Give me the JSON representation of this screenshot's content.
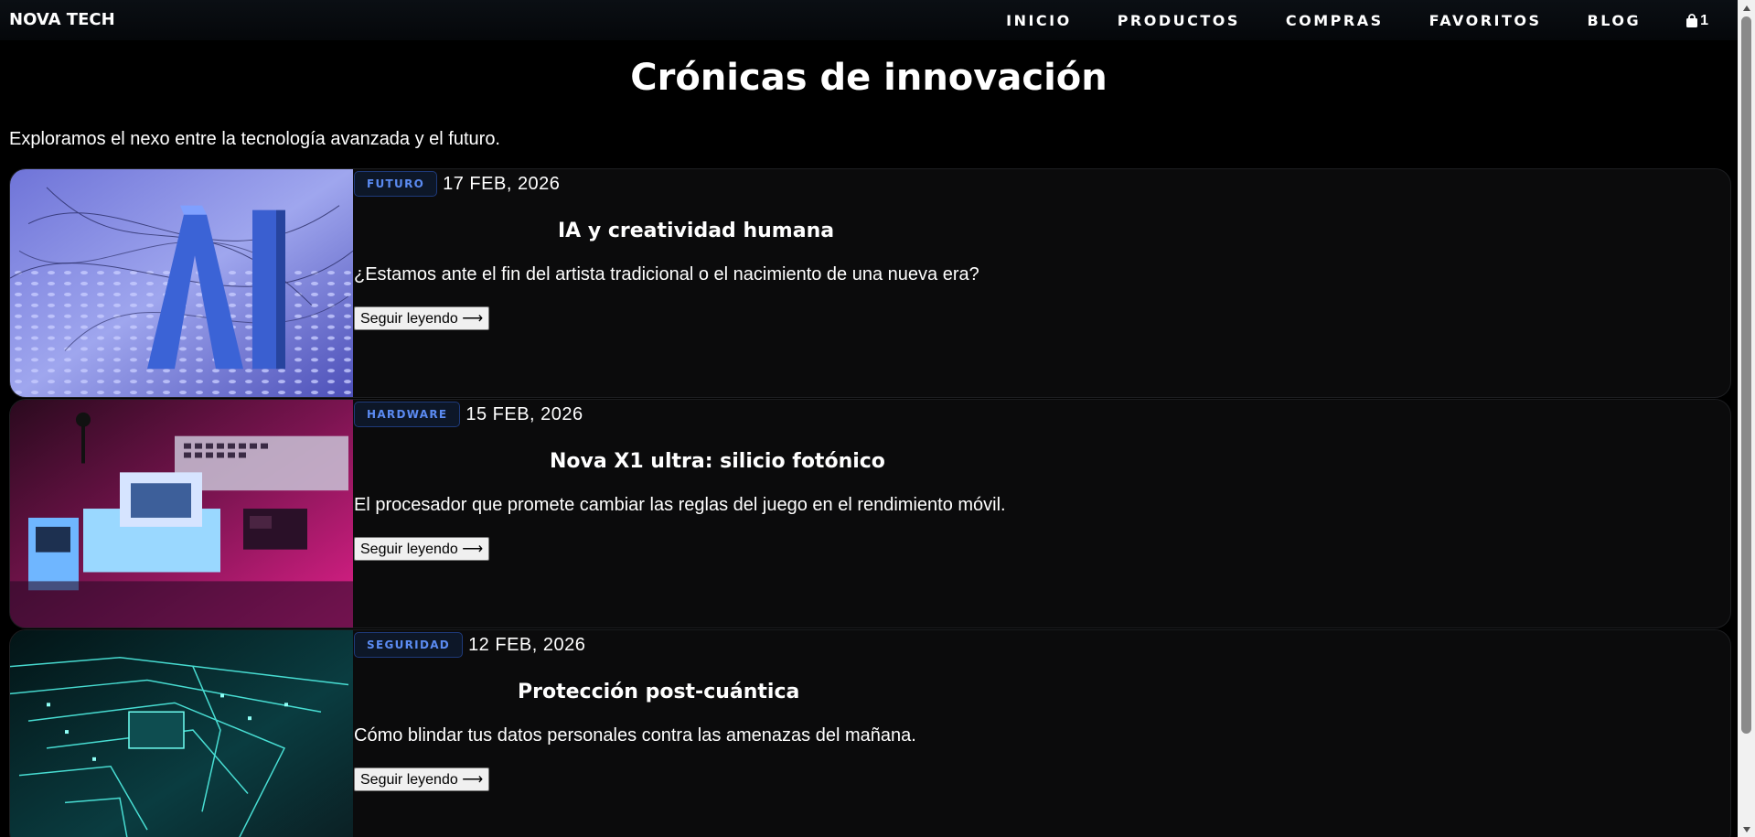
{
  "header": {
    "logo": "NOVA TECH",
    "nav": [
      "INICIO",
      "PRODUCTOS",
      "COMPRAS",
      "FAVORITOS",
      "BLOG"
    ],
    "cart_count": "1"
  },
  "hero": {
    "title": "Crónicas de innovación",
    "subtitle": "Exploramos el nexo entre la tecnología avanzada y el futuro."
  },
  "posts": [
    {
      "tag": "FUTURO",
      "date": "17 FEB, 2026",
      "title": "IA y creatividad humana",
      "excerpt": "¿Estamos ante el fin del artista tradicional o el nacimiento de una nueva era?",
      "button": "Seguir leyendo ⟶"
    },
    {
      "tag": "HARDWARE",
      "date": "15 FEB, 2026",
      "title": "Nova X1 ultra: silicio fotónico",
      "excerpt": "El procesador que promete cambiar las reglas del juego en el rendimiento móvil.",
      "button": "Seguir leyendo ⟶"
    },
    {
      "tag": "SEGURIDAD",
      "date": "12 FEB, 2026",
      "title": "Protección post-cuántica",
      "excerpt": "Cómo blindar tus datos personales contra las amenazas del mañana.",
      "button": "Seguir leyendo ⟶"
    }
  ],
  "colors": {
    "background": "#000000",
    "card": "#0b0b0c",
    "tag_text": "#5b8bf2"
  }
}
